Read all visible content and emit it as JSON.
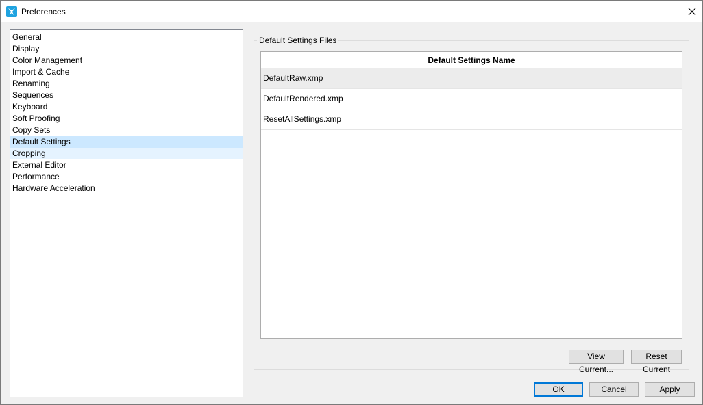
{
  "window": {
    "title": "Preferences",
    "app_icon": "butterfly-logo-icon",
    "close_icon": "close-icon"
  },
  "nav": {
    "items": [
      {
        "label": "General"
      },
      {
        "label": "Display"
      },
      {
        "label": "Color Management"
      },
      {
        "label": "Import & Cache"
      },
      {
        "label": "Renaming"
      },
      {
        "label": "Sequences"
      },
      {
        "label": "Keyboard"
      },
      {
        "label": "Soft Proofing"
      },
      {
        "label": "Copy Sets"
      },
      {
        "label": "Default Settings",
        "state": "selected"
      },
      {
        "label": "Cropping",
        "state": "hover"
      },
      {
        "label": "External Editor"
      },
      {
        "label": "Performance"
      },
      {
        "label": "Hardware Acceleration"
      }
    ]
  },
  "panel": {
    "group_label": "Default Settings Files",
    "table": {
      "header": "Default Settings Name",
      "rows": [
        {
          "name": "DefaultRaw.xmp",
          "selected": true
        },
        {
          "name": "DefaultRendered.xmp",
          "selected": false
        },
        {
          "name": "ResetAllSettings.xmp",
          "selected": false
        }
      ]
    },
    "buttons": {
      "view_current": "View Current...",
      "reset_current": "Reset Current"
    }
  },
  "footer": {
    "ok": "OK",
    "cancel": "Cancel",
    "apply": "Apply"
  },
  "colors": {
    "accent": "#0078d7",
    "selection": "#cce8ff",
    "hover": "#e5f3ff",
    "brand_icon": "#1fa3e0"
  }
}
